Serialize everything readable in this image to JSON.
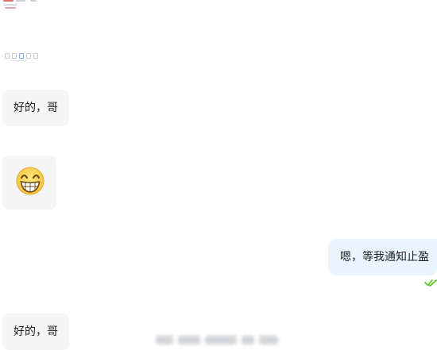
{
  "chat": {
    "messages": [
      {
        "id": "m1",
        "direction": "incoming",
        "type": "text",
        "text": "好的，哥"
      },
      {
        "id": "m2",
        "direction": "incoming",
        "type": "sticker",
        "icon": "grinning-face-icon"
      },
      {
        "id": "m3",
        "direction": "outgoing",
        "type": "text",
        "text": "嗯，等我通知止盈",
        "status_icon": "double-check-icon"
      },
      {
        "id": "m4",
        "direction": "incoming",
        "type": "text",
        "text": "好的，哥"
      }
    ]
  },
  "colors": {
    "incoming_bubble": "#f5f5f5",
    "outgoing_bubble": "#e9f4fe",
    "read_check": "#52c41a"
  }
}
